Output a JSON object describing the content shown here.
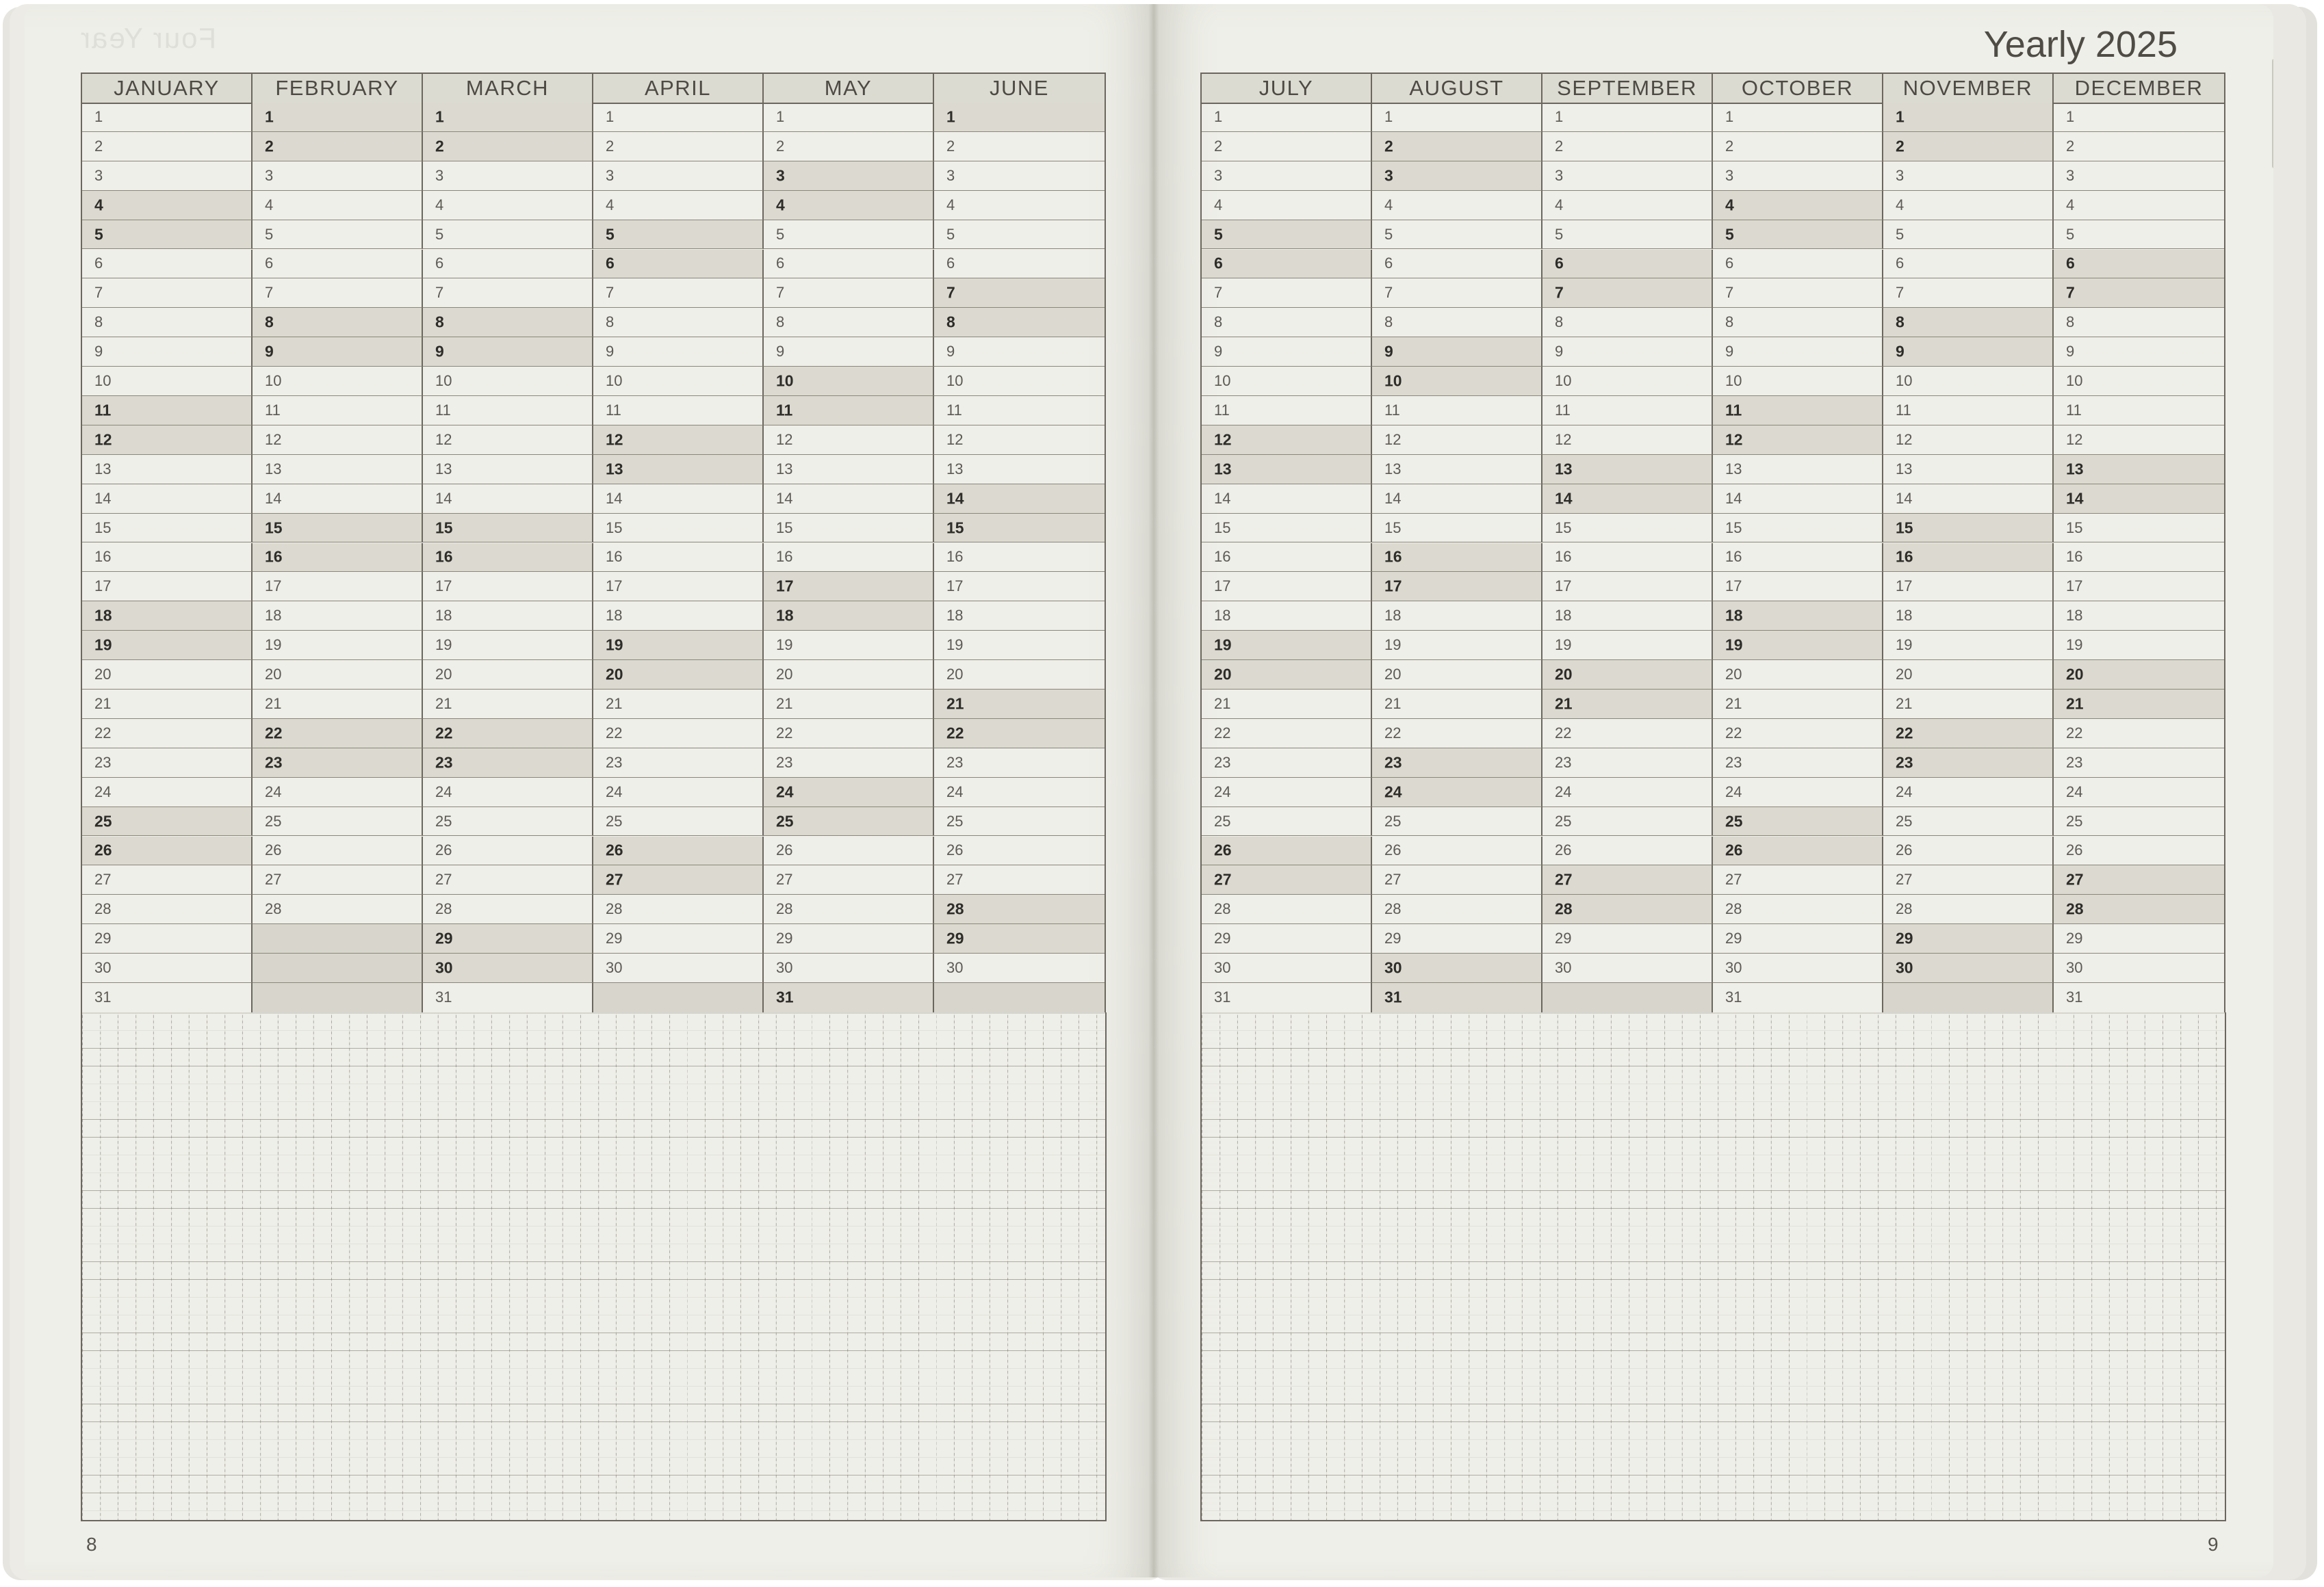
{
  "left_page": {
    "page_number": "8",
    "months": [
      "JANUARY",
      "FEBRUARY",
      "MARCH",
      "APRIL",
      "MAY",
      "JUNE"
    ],
    "month_lengths": [
      31,
      28,
      31,
      30,
      31,
      30
    ],
    "highlights": [
      [
        4,
        5,
        11,
        12,
        18,
        19,
        25,
        26
      ],
      [
        1,
        2,
        8,
        9,
        15,
        16,
        22,
        23
      ],
      [
        1,
        2,
        8,
        9,
        15,
        16,
        22,
        23,
        29,
        30
      ],
      [
        5,
        6,
        12,
        13,
        19,
        20,
        26,
        27
      ],
      [
        3,
        4,
        10,
        11,
        17,
        18,
        24,
        25,
        31
      ],
      [
        1,
        7,
        8,
        14,
        15,
        21,
        22,
        28,
        29
      ]
    ],
    "ghost_title": "Four Year"
  },
  "right_page": {
    "title": "Yearly 2025",
    "page_number": "9",
    "months": [
      "JULY",
      "AUGUST",
      "SEPTEMBER",
      "OCTOBER",
      "NOVEMBER",
      "DECEMBER"
    ],
    "month_lengths": [
      31,
      31,
      30,
      31,
      30,
      31
    ],
    "highlights": [
      [
        5,
        6,
        12,
        13,
        19,
        20,
        26,
        27
      ],
      [
        2,
        3,
        9,
        10,
        16,
        17,
        23,
        24,
        30,
        31
      ],
      [
        6,
        7,
        13,
        14,
        20,
        21,
        27,
        28
      ],
      [
        4,
        5,
        11,
        12,
        18,
        19,
        25,
        26
      ],
      [
        1,
        2,
        8,
        9,
        15,
        16,
        22,
        23,
        29,
        30
      ],
      [
        6,
        7,
        13,
        14,
        20,
        21,
        27,
        28
      ]
    ]
  },
  "colors": {
    "paper": "#efefe9",
    "header": "#dcdbd2",
    "weekend": "#dcdad0",
    "rule": "#6b675e"
  }
}
